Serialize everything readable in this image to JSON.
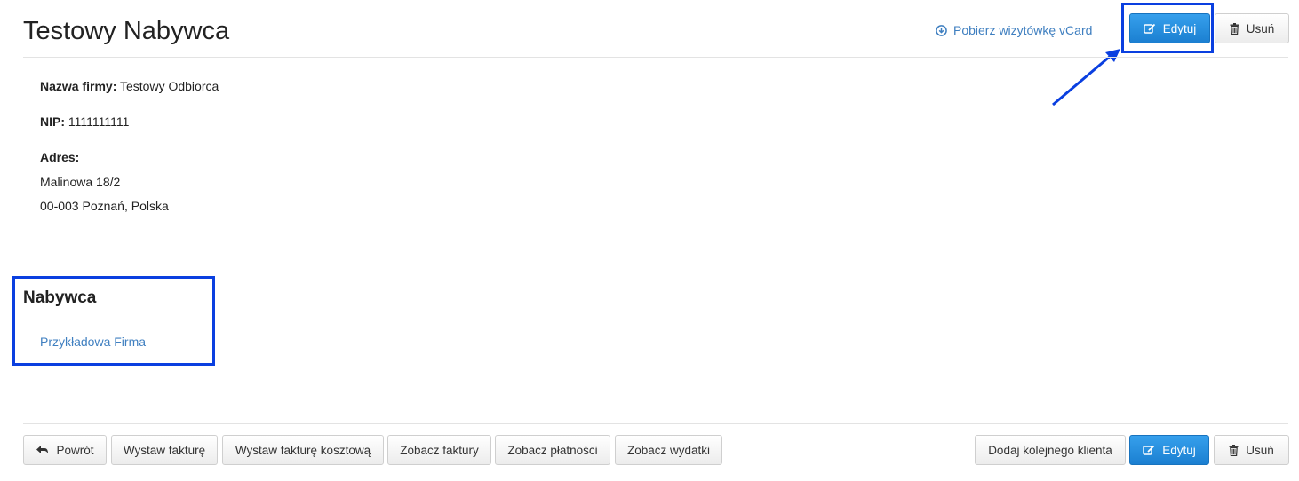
{
  "header": {
    "title": "Testowy Nabywca",
    "vcard_link": "Pobierz wizytówkę vCard",
    "edit_label": "Edytuj",
    "delete_label": "Usuń"
  },
  "details": {
    "company_label": "Nazwa firmy:",
    "company_value": "Testowy Odbiorca",
    "nip_label": "NIP:",
    "nip_value": "1111111111",
    "address_label": "Adres:",
    "address_line1": "Malinowa 18/2",
    "address_line2": "00-003 Poznań, Polska"
  },
  "buyer_section": {
    "title": "Nabywca",
    "link": "Przykładowa Firma"
  },
  "footer": {
    "back_label": "Powrót",
    "issue_invoice": "Wystaw fakturę",
    "issue_cost_invoice": "Wystaw fakturę kosztową",
    "view_invoices": "Zobacz faktury",
    "view_payments": "Zobacz płatności",
    "view_expenses": "Zobacz wydatki",
    "add_client": "Dodaj kolejnego klienta",
    "edit_label": "Edytuj",
    "delete_label": "Usuń"
  },
  "colors": {
    "primary": "#1b7fd1",
    "link": "#3f7fc0",
    "annotation": "#0a3fe0"
  },
  "icons": {
    "vcard": "download-circle-icon",
    "edit": "edit-icon",
    "delete": "trash-icon",
    "back": "arrow-left-icon"
  }
}
